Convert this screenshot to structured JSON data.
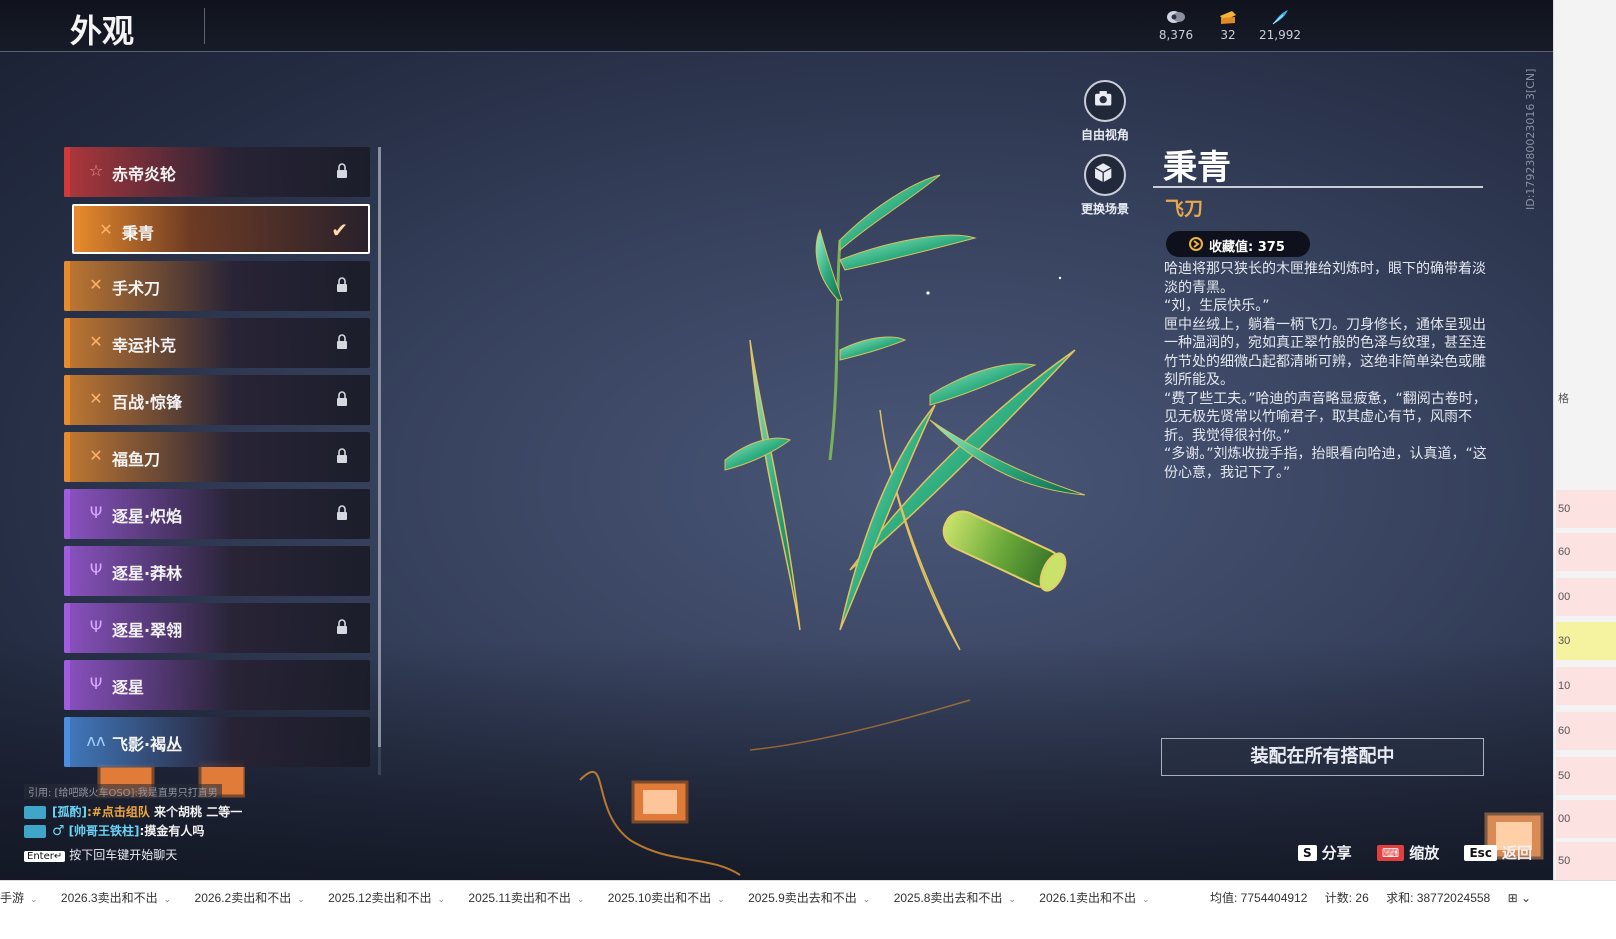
{
  "topbar": {
    "title": "外观",
    "currencies": [
      {
        "icon": "gem-coin-icon",
        "value": "8,376"
      },
      {
        "icon": "ticket-icon",
        "value": "32"
      },
      {
        "icon": "feather-icon",
        "value": "21,992"
      }
    ]
  },
  "list": {
    "items": [
      {
        "label": "赤帝炎轮",
        "accent": "#d23a3a",
        "glyph": "star-icon",
        "glyph_char": "☆",
        "glyph_color": "#ff8a8a",
        "locked": true,
        "selected": false
      },
      {
        "label": "秉青",
        "accent": "#e88b2c",
        "glyph": "blades-icon",
        "glyph_char": "✕",
        "glyph_color": "#ffb36a",
        "locked": false,
        "selected": true
      },
      {
        "label": "手术刀",
        "accent": "#e88b2c",
        "glyph": "blades-icon",
        "glyph_char": "✕",
        "glyph_color": "#ffb36a",
        "locked": true,
        "selected": false
      },
      {
        "label": "幸运扑克",
        "accent": "#e88b2c",
        "glyph": "blades-icon",
        "glyph_char": "✕",
        "glyph_color": "#ffb36a",
        "locked": true,
        "selected": false
      },
      {
        "label": "百战·惊锋",
        "accent": "#e88b2c",
        "glyph": "blades-icon",
        "glyph_char": "✕",
        "glyph_color": "#ffb36a",
        "locked": true,
        "selected": false
      },
      {
        "label": "福鱼刀",
        "accent": "#e88b2c",
        "glyph": "blades-icon",
        "glyph_char": "✕",
        "glyph_color": "#ffb36a",
        "locked": true,
        "selected": false
      },
      {
        "label": "逐星·炽焰",
        "accent": "#a35be0",
        "glyph": "trident-icon",
        "glyph_char": "Ψ",
        "glyph_color": "#d9a6ff",
        "locked": true,
        "selected": false
      },
      {
        "label": "逐星·莽林",
        "accent": "#a35be0",
        "glyph": "trident-icon",
        "glyph_char": "Ψ",
        "glyph_color": "#d9a6ff",
        "locked": false,
        "selected": false
      },
      {
        "label": "逐星·翠翎",
        "accent": "#a35be0",
        "glyph": "trident-icon",
        "glyph_char": "Ψ",
        "glyph_color": "#d9a6ff",
        "locked": true,
        "selected": false
      },
      {
        "label": "逐星",
        "accent": "#a35be0",
        "glyph": "trident-icon",
        "glyph_char": "Ψ",
        "glyph_color": "#d9a6ff",
        "locked": false,
        "selected": false
      },
      {
        "label": "飞影·褐丛",
        "accent": "#4a8fe0",
        "glyph": "wings-icon",
        "glyph_char": "ʌʌ",
        "glyph_color": "#9fd0ff",
        "locked": false,
        "selected": false
      }
    ]
  },
  "view_buttons": {
    "free_camera": "自由视角",
    "change_scene": "更换场景"
  },
  "detail": {
    "name": "秉青",
    "type": "飞刀",
    "collect_label": "收藏值: 375",
    "description": [
      "哈迪将那只狭长的木匣推给刘炼时，眼下的确带着淡淡的青黑。",
      "“刘，生辰快乐。”",
      "匣中丝绒上，躺着一柄飞刀。刀身修长，通体呈现出一种温润的，宛如真正翠竹般的色泽与纹理，甚至连竹节处的细微凸起都清晰可辨，这绝非简单染色或雕刻所能及。",
      "“费了些工夫。”哈迪的声音略显疲惫，“翻阅古卷时，见无极先贤常以竹喻君子，取其虚心有节，风雨不折。我觉得很衬你。”",
      "“多谢。”刘炼收拢手指，抬眼看向哈迪，认真道，“这份心意，我记下了。”"
    ],
    "equip_button": "装配在所有搭配中"
  },
  "chat": {
    "quote": "引用: [给吧跳火车OSO]:我是直男只打直男",
    "lines": [
      {
        "name": "[孤酌]",
        "highlight": ":#点击组队",
        "text": " 来个胡桃 二等一"
      },
      {
        "sex": "♂",
        "name": "[帅哥王铁柱]",
        "highlight": "",
        "text": ":摸金有人吗"
      }
    ],
    "enter_key": "Enter↵",
    "enter_hint": "按下回车键开始聊天"
  },
  "footer_keys": [
    {
      "key": "S",
      "label": "分享"
    },
    {
      "key": "⌨",
      "label": "缩放"
    },
    {
      "key": "Esc",
      "label": "返回"
    }
  ],
  "side_id": "ID:1792380023016 3[CN]",
  "spreadsheet": {
    "tabs": [
      "手游",
      "2026.3卖出和不出",
      "2026.2卖出和不出",
      "2025.12卖出和不出",
      "2025.11卖出和不出",
      "2025.10卖出和不出",
      "2025.9卖出去和不出",
      "2025.8卖出去和不出",
      "2026.1卖出和不出"
    ],
    "stats": [
      "均值: 7754404912",
      "计数: 26",
      "求和: 38772024558"
    ],
    "right_cells": [
      "格",
      "50",
      "60",
      "00",
      "30",
      "10",
      "60",
      "50",
      "00",
      "50"
    ]
  }
}
